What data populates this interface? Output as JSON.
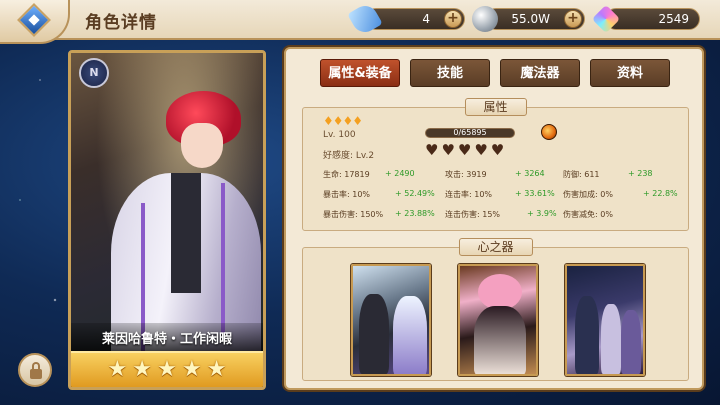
{
  "header": {
    "title": "角色详情",
    "resources": [
      {
        "name": "crystal",
        "icon": "crystal-icon",
        "value": "4"
      },
      {
        "name": "silver",
        "icon": "silver-coin-icon",
        "value": "55.0W"
      },
      {
        "name": "gem",
        "icon": "rainbow-gem-icon",
        "value": "2549"
      }
    ]
  },
  "character": {
    "name": "莱因哈鲁特・工作闲暇",
    "stars": [
      "★",
      "★",
      "★",
      "★",
      "★"
    ],
    "emblem": "N"
  },
  "tabs": [
    {
      "label": "属性&装备",
      "active": true
    },
    {
      "label": "技能",
      "active": false
    },
    {
      "label": "魔法器",
      "active": false
    },
    {
      "label": "资料",
      "active": false
    }
  ],
  "attributes": {
    "header": "属性",
    "diamonds": "♦♦♦♦",
    "level": "Lv. 100",
    "exp": "0/65895",
    "affinity_label": "好感度: Lv.2",
    "hearts": "♥♥♥♥♥",
    "stats": [
      {
        "label": "生命: 17819",
        "bonus": "+ 2490"
      },
      {
        "label": "攻击: 3919",
        "bonus": "+ 3264"
      },
      {
        "label": "防御: 611",
        "bonus": "+ 238"
      },
      {
        "label": "暴击率: 10%",
        "bonus": "+ 52.49%"
      },
      {
        "label": "连击率: 10%",
        "bonus": "+ 33.61%"
      },
      {
        "label": "伤害加成: 0%",
        "bonus": "+ 22.8%"
      },
      {
        "label": "暴击伤害: 150%",
        "bonus": "+ 23.88%"
      },
      {
        "label": "连击伤害: 15%",
        "bonus": "+ 3.9%"
      },
      {
        "label": "伤害减免: 0%",
        "bonus": ""
      }
    ]
  },
  "soul_items": {
    "header": "心之器",
    "items": [
      "artifact-1",
      "artifact-2",
      "artifact-3"
    ]
  }
}
